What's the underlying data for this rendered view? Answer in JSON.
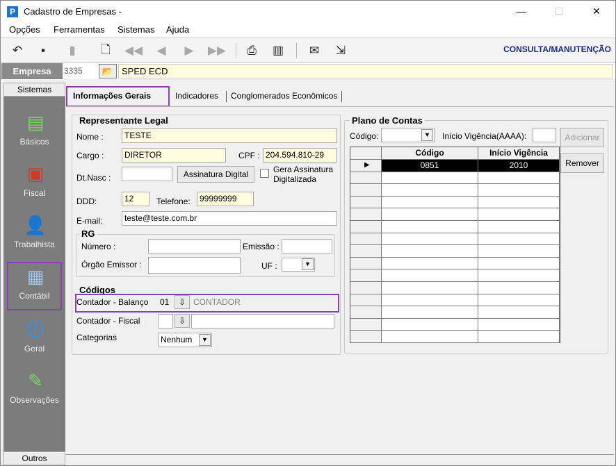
{
  "window": {
    "title": "Cadastro de Empresas -",
    "logo": "P",
    "minimize_icon": "—",
    "maximize_icon": "☐",
    "close_icon": "✕"
  },
  "menu": [
    "Opções",
    "Ferramentas",
    "Sistemas",
    "Ajuda"
  ],
  "toolbar": {
    "mode_label": "CONSULTA/MANUTENÇÃO",
    "icons": [
      "undo-icon",
      "save-icon",
      "new-icon",
      "preview-icon",
      "first-icon",
      "prev-icon",
      "next-icon",
      "last-icon",
      "print-icon",
      "scan-icon",
      "export-icon",
      "exit-icon"
    ]
  },
  "empresa": {
    "label": "Empresa",
    "code": "3335",
    "name": "SPED ECD",
    "folder_icon": "📂"
  },
  "left_panel": {
    "header": "Sistemas",
    "footer": "Outros",
    "items": [
      {
        "label": "Básicos",
        "icon": "book-icon",
        "glyph": "▤"
      },
      {
        "label": "Fiscal",
        "icon": "tag-icon",
        "glyph": "▣"
      },
      {
        "label": "Trabalhista",
        "icon": "worker-icon",
        "glyph": "👤"
      },
      {
        "label": "Contábil",
        "icon": "calculator-icon",
        "glyph": "▦"
      },
      {
        "label": "Geral",
        "icon": "globe-info-icon",
        "glyph": "🛈"
      },
      {
        "label": "Observações",
        "icon": "pen-icon",
        "glyph": "✎"
      }
    ]
  },
  "tabs": [
    "Informações Gerais",
    "Indicadores",
    "Conglomerados Econômicos"
  ],
  "representante": {
    "title": "Representante Legal",
    "nome_label": "Nome :",
    "nome": "TESTE",
    "cargo_label": "Cargo :",
    "cargo": "DIRETOR",
    "cpf_label": "CPF :",
    "cpf": "204.594.810-29",
    "dtnasc_label": "Dt.Nasc :",
    "dtnasc": "",
    "assinatura_btn": "Assinatura Digital",
    "gera_label": "Gera Assinatura Digitalizada",
    "ddd_label": "DDD:",
    "ddd": "12",
    "telefone_label": "Telefone:",
    "telefone": "99999999",
    "email_label": "E-mail:",
    "email": "teste@teste.com.br"
  },
  "rg": {
    "title": "RG",
    "numero_label": "Número :",
    "numero": "",
    "emissao_label": "Emissão :",
    "emissao": "",
    "orgao_label": "Órgão Emissor :",
    "orgao": "",
    "uf_label": "UF :",
    "uf": ""
  },
  "codigos": {
    "title": "Códigos",
    "balanco_label": "Contador - Balanço",
    "balanco_code": "01",
    "balanco_name": "CONTADOR",
    "fiscal_label": "Contador - Fiscal",
    "fiscal_code": "",
    "fiscal_name": "",
    "categorias_label": "Categorias",
    "categorias": "Nenhum"
  },
  "plano": {
    "title": "Plano de Contas",
    "codigo_label": "Código:",
    "codigo": "",
    "vigencia_label": "Início Vigência(AAAA):",
    "vigencia": "",
    "adicionar_btn": "Adicionar",
    "remover_btn": "Remover",
    "columns": [
      "Código",
      "Início Vigência"
    ],
    "rows": [
      [
        "0851",
        "2010"
      ]
    ],
    "row_marker": "▶"
  }
}
